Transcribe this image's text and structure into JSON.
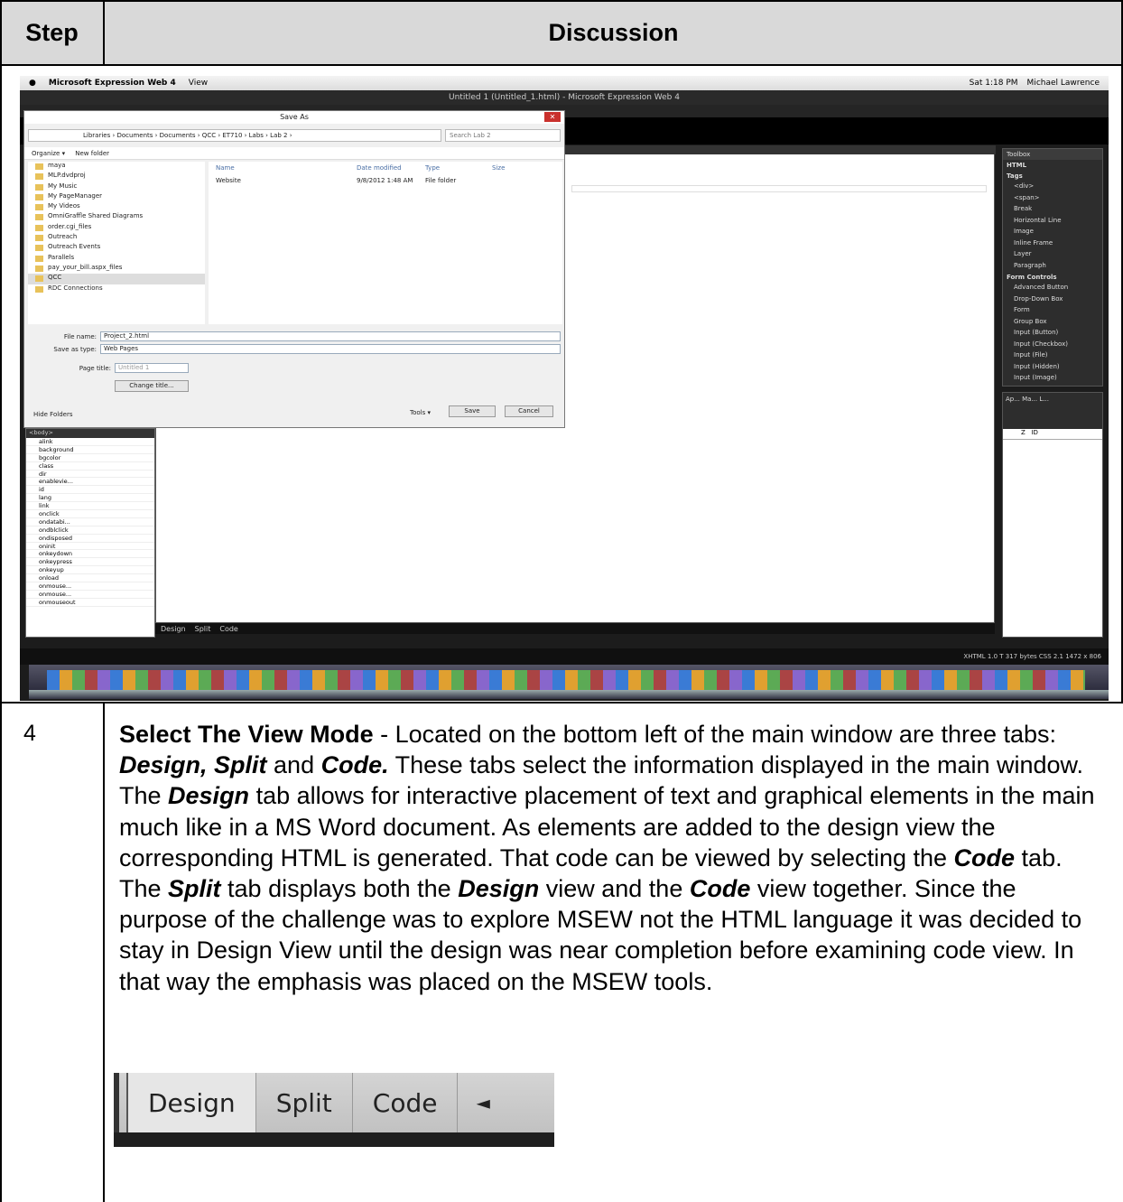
{
  "table": {
    "header_step": "Step",
    "header_discussion": "Discussion",
    "row_step_number": "4"
  },
  "discussion": {
    "p1_bold": "Select The View Mode",
    "p1_a": " - Located on the bottom left of the main window are three tabs: ",
    "t_design_split": "Design, Split",
    "p1_b": " and ",
    "t_code": "Code.",
    "p1_c": "  These tabs select the information displayed in the main window.  The ",
    "t_design": "Design",
    "p1_d": " tab allows for interactive placement of text and graphical elements in the main much like in a MS Word document.  As elements are added to the design view the corresponding HTML is generated.  That code can be viewed by selecting the ",
    "t_code2": "Code",
    "p1_e": " tab. The ",
    "t_split": "Split",
    "p1_f": " tab displays both the ",
    "t_design2": "Design",
    "p1_g": " view and the ",
    "t_code3": "Code",
    "p1_h": " view together.   Since the purpose of the challenge was to explore MSEW not the HTML language it was decided to stay in Design View until the design was near completion before examining code view.  In that way the emphasis was placed on the MSEW tools."
  },
  "crop": {
    "tab_design": "Design",
    "tab_split": "Split",
    "tab_code": "Code",
    "arrow": "◄"
  },
  "screenshot": {
    "mac_app": "Microsoft Expression Web 4",
    "mac_menu": "View",
    "mac_clock": "Sat 1:18 PM",
    "mac_user": "Michael Lawrence",
    "window_title": "Untitled 1 (Untitled_1.html) - Microsoft Expression Web 4",
    "dialog_title": "Save As",
    "address": "Libraries › Documents › Documents › QCC › ET710 › Labs › Lab 2 ›",
    "search_placeholder": "Search Lab 2",
    "organize": "Organize ▾",
    "new_folder": "New folder",
    "folders": [
      "maya",
      "MLP.dvdproj",
      "My Music",
      "My PageManager",
      "My Videos",
      "OmniGraffle Shared Diagrams",
      "order.cgi_files",
      "Outreach",
      "Outreach Events",
      "Parallels",
      "pay_your_bill.aspx_files",
      "QCC",
      "RDC Connections"
    ],
    "col_name": "Name",
    "col_date": "Date modified",
    "col_type": "Type",
    "col_size": "Size",
    "file_name": "Website",
    "file_date": "9/8/2012 1:48 AM",
    "file_type": "File folder",
    "lbl_filename": "File name:",
    "val_filename": "Project_2.html",
    "lbl_savetype": "Save as type:",
    "val_savetype": "Web Pages",
    "lbl_pagetitle": "Page title:",
    "val_pagetitle": "Untitled 1",
    "btn_change_title": "Change title...",
    "hide_folders": "Hide Folders",
    "tools": "Tools ▾",
    "btn_save": "Save",
    "btn_cancel": "Cancel",
    "toolbox_title": "Toolbox",
    "toolbox_html": "HTML",
    "toolbox_tags": "Tags",
    "toolbox_tag_items": [
      "<div>",
      "<span>",
      "Break",
      "Horizontal Line",
      "Image",
      "Inline Frame",
      "Layer",
      "Paragraph"
    ],
    "toolbox_form": "Form Controls",
    "toolbox_form_items": [
      "Advanced Button",
      "Drop-Down Box",
      "Form",
      "Group Box",
      "Input (Button)",
      "Input (Checkbox)",
      "Input (File)",
      "Input (Hidden)",
      "Input (Image)"
    ],
    "apps_tabs": "Ap...  Ma...  L...",
    "apps_col_z": "Z",
    "apps_col_id": "ID",
    "body_tag": "<body>",
    "tag_props": [
      "alink",
      "background",
      "bgcolor",
      "class",
      "dir",
      "enablevie...",
      "id",
      "lang",
      "link",
      "onclick",
      "ondatabi...",
      "ondblclick",
      "ondisposed",
      "oninit",
      "onkeydown",
      "onkeypress",
      "onkeyup",
      "onload",
      "onmouse...",
      "onmouse...",
      "onmouseout"
    ],
    "bottom_design": "Design",
    "bottom_split": "Split",
    "bottom_code": "Code",
    "status": "XHTML 1.0 T   317 bytes      CSS 2.1   1472 x 806"
  }
}
